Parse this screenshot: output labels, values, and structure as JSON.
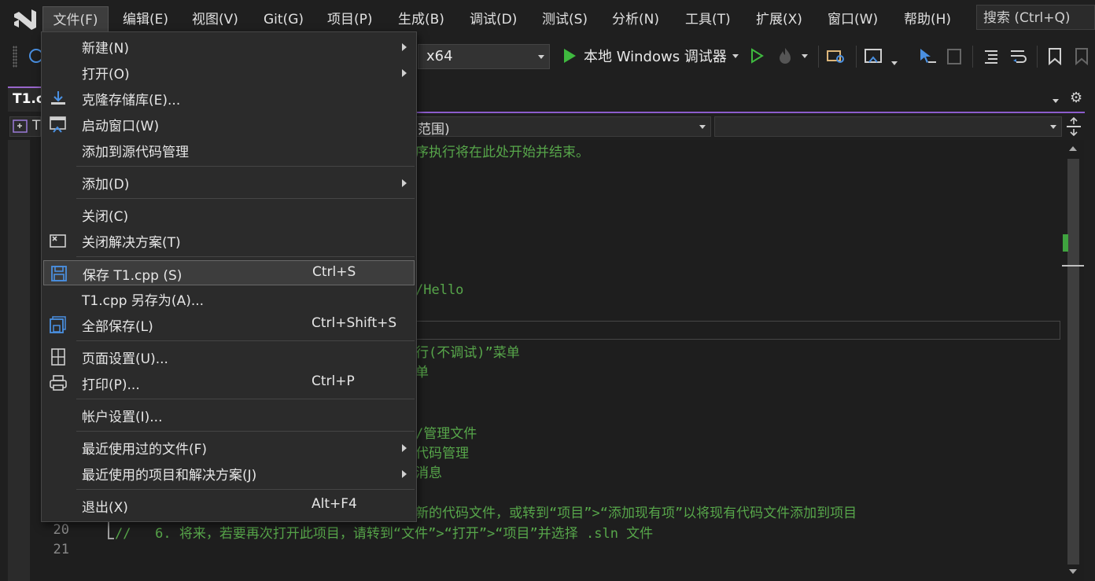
{
  "menubar": {
    "items": [
      "文件(F)",
      "编辑(E)",
      "视图(V)",
      "Git(G)",
      "项目(P)",
      "生成(B)",
      "调试(D)",
      "测试(S)",
      "分析(N)",
      "工具(T)",
      "扩展(X)",
      "窗口(W)",
      "帮助(H)"
    ],
    "search_placeholder": "搜索 (Ctrl+Q)"
  },
  "toolbar": {
    "platform": "x64",
    "run_label": "本地 Windows 调试器"
  },
  "tab": {
    "label": "T1.c"
  },
  "navbar": {
    "scope_text": "范围)",
    "left_text": "T"
  },
  "editor": {
    "code_fragments": [
      "序执行将在此处开始并结束。",
      "/Hello",
      "行(不调试)”菜单",
      "单",
      "/管理文件",
      "代码管理",
      "消息",
      "新的代码文件，或转到“项目”>“添加现有项”以将现有代码文件添加到项目"
    ],
    "line20": {
      "num": "20",
      "text": "//   6. 将来，若要再次打开此项目，请转到“文件”>“打开”>“项目”并选择 .sln 文件"
    },
    "line21": {
      "num": "21"
    }
  },
  "file_menu": {
    "items": [
      {
        "label": "新建(N)",
        "shortcut": "",
        "submenu": true
      },
      {
        "label": "打开(O)",
        "shortcut": "",
        "submenu": true
      },
      {
        "label": "克隆存储库(E)...",
        "shortcut": "",
        "icon": "download-icon"
      },
      {
        "label": "启动窗口(W)",
        "shortcut": "",
        "icon": "start-window-icon"
      },
      {
        "label": "添加到源代码管理",
        "shortcut": ""
      },
      {
        "label": "添加(D)",
        "shortcut": "",
        "submenu": true
      },
      {
        "label": "关闭(C)",
        "shortcut": ""
      },
      {
        "label": "关闭解决方案(T)",
        "shortcut": "",
        "icon": "close-solution-icon"
      },
      {
        "label": "保存 T1.cpp (S)",
        "shortcut": "Ctrl+S",
        "icon": "save-icon"
      },
      {
        "label": "T1.cpp 另存为(A)...",
        "shortcut": ""
      },
      {
        "label": "全部保存(L)",
        "shortcut": "Ctrl+Shift+S",
        "icon": "save-all-icon"
      },
      {
        "label": "页面设置(U)...",
        "shortcut": "",
        "icon": "page-setup-icon"
      },
      {
        "label": "打印(P)...",
        "shortcut": "Ctrl+P",
        "icon": "print-icon"
      },
      {
        "label": "帐户设置(I)...",
        "shortcut": ""
      },
      {
        "label": "最近使用过的文件(F)",
        "shortcut": "",
        "submenu": true
      },
      {
        "label": "最近使用的项目和解决方案(J)",
        "shortcut": "",
        "submenu": true
      },
      {
        "label": "退出(X)",
        "shortcut": "Alt+F4"
      }
    ]
  },
  "colors": {
    "accent": "#8c5ccc",
    "comment": "#57a64a",
    "menu_bg": "#2b2b2b",
    "run_green": "#3fb93f"
  }
}
